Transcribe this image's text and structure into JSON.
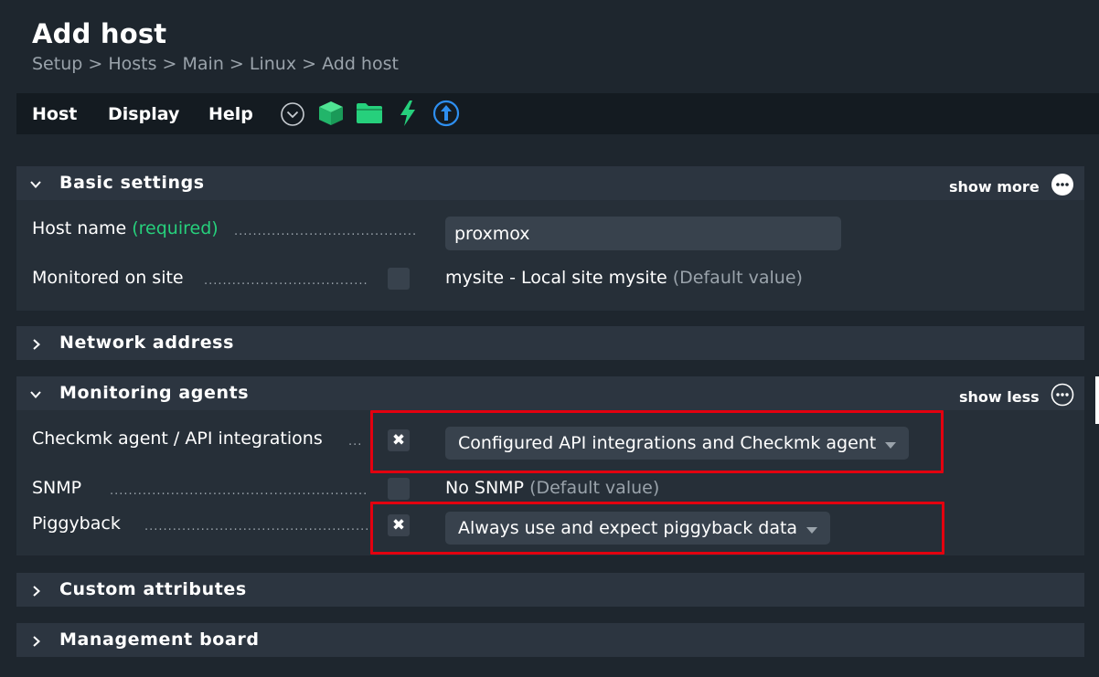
{
  "page": {
    "title": "Add host",
    "breadcrumb": [
      "Setup",
      ">",
      "Hosts",
      ">",
      "Main",
      ">",
      "Linux",
      ">",
      "Add host"
    ]
  },
  "menubar": {
    "items": [
      "Host",
      "Display",
      "Help"
    ],
    "icons": [
      "chevron-circle-down-icon",
      "host-cube-icon",
      "folder-icon",
      "activate-changes-icon",
      "update-arrow-icon"
    ],
    "colors": {
      "green": "#26d07c",
      "blue": "#2e8ff0"
    }
  },
  "basic_settings": {
    "title": "Basic settings",
    "toggle_label": "show more",
    "host_name": {
      "label": "Host name",
      "required": "(required)",
      "value": "proxmox"
    },
    "monitored_on_site": {
      "label": "Monitored on site",
      "value": "mysite - Local site mysite",
      "default_note": "(Default value)"
    }
  },
  "network_address": {
    "title": "Network address"
  },
  "monitoring_agents": {
    "title": "Monitoring agents",
    "toggle_label": "show less",
    "checkmk_agent": {
      "label": "Checkmk agent / API integrations",
      "checkbox_mark": "✖",
      "selected": "Configured API integrations and Checkmk agent"
    },
    "snmp": {
      "label": "SNMP",
      "value": "No SNMP",
      "default_note": "(Default value)"
    },
    "piggyback": {
      "label": "Piggyback",
      "checkbox_mark": "✖",
      "selected": "Always use and expect piggyback data"
    },
    "highlight_color": "#e3000f"
  },
  "custom_attributes": {
    "title": "Custom attributes"
  },
  "management_board": {
    "title": "Management board"
  }
}
